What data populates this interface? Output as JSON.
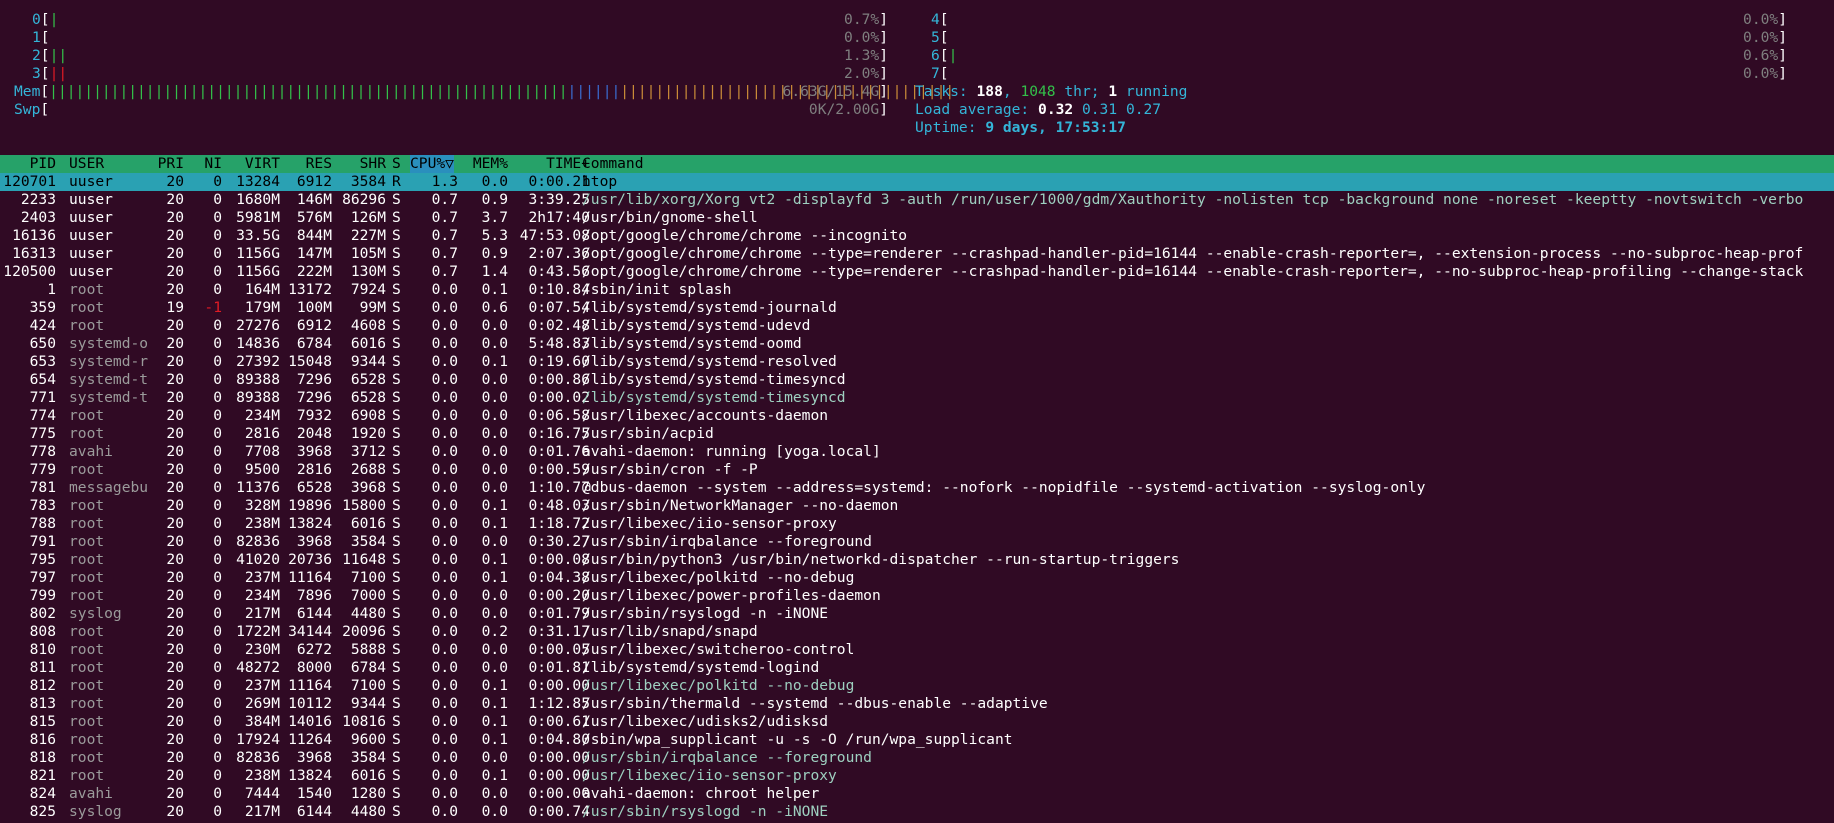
{
  "cpus_left": [
    {
      "id": "0",
      "bar": "|",
      "bar_color": "green",
      "pct": "0.7%"
    },
    {
      "id": "1",
      "bar": "",
      "bar_color": "green",
      "pct": "0.0%"
    },
    {
      "id": "2",
      "bar": "||",
      "bar_color": "green",
      "pct": "1.3%"
    },
    {
      "id": "3",
      "bar": "||",
      "bar_color": "red",
      "pct": "2.0%"
    }
  ],
  "cpus_right": [
    {
      "id": "4",
      "bar": "",
      "bar_color": "green",
      "pct": "0.0%"
    },
    {
      "id": "5",
      "bar": "",
      "bar_color": "green",
      "pct": "0.0%"
    },
    {
      "id": "6",
      "bar": "|",
      "bar_color": "green",
      "pct": "0.6%"
    },
    {
      "id": "7",
      "bar": "",
      "bar_color": "green",
      "pct": "0.0%"
    }
  ],
  "mem": {
    "label": "Mem",
    "green": "|||||||||||||||||||||||||||||||||||||||||||||||||||||||||||",
    "blue": "||||||",
    "orange": "||||||||||||||||||||||||||||||||||||||",
    "value": "6.63G/15.4G"
  },
  "swp": {
    "label": "Swp",
    "value": "0K/2.00G"
  },
  "tasks": {
    "label": "Tasks:",
    "count": "188",
    "thr": "1048",
    "thr_label": " thr;",
    "running": "1",
    "running_label": " running"
  },
  "load": {
    "label": "Load average:",
    "v1": "0.32",
    "v5": "0.31",
    "v15": "0.27"
  },
  "uptime": {
    "label": "Uptime:",
    "value": "9 days, 17:53:17"
  },
  "header": {
    "pid": "PID",
    "user": "USER",
    "pri": "PRI",
    "ni": "NI",
    "virt": "VIRT",
    "res": "RES",
    "shr": "SHR",
    "s": "S",
    "cpu": "CPU%▽",
    "mem": "MEM%",
    "time": "TIME+",
    "cmd": "Command"
  },
  "processes": [
    {
      "pid": "120701",
      "user": "uuser",
      "pri": "20",
      "ni": "0",
      "virt": "13284",
      "res": "6912",
      "shr": "3584",
      "s": "R",
      "cpu": "1.3",
      "mem": "0.0",
      "time": "0:00.21",
      "cmd": "htop",
      "selected": true
    },
    {
      "pid": "2233",
      "user": "uuser",
      "pri": "20",
      "ni": "0",
      "virt": "1680M",
      "res": "146M",
      "shr": "86296",
      "s": "S",
      "cpu": "0.7",
      "mem": "0.9",
      "time": "3:39.25",
      "cmd": "/usr/lib/xorg/Xorg vt2 -displayfd 3 -auth /run/user/1000/gdm/Xauthority -nolisten tcp -background none -noreset -keeptty -novtswitch -verbo",
      "thread": true
    },
    {
      "pid": "2403",
      "user": "uuser",
      "pri": "20",
      "ni": "0",
      "virt": "5981M",
      "res": "576M",
      "shr": "126M",
      "s": "S",
      "cpu": "0.7",
      "mem": "3.7",
      "time": "2h17:40",
      "cmd": "/usr/bin/gnome-shell"
    },
    {
      "pid": "16136",
      "user": "uuser",
      "pri": "20",
      "ni": "0",
      "virt": "33.5G",
      "res": "844M",
      "shr": "227M",
      "s": "S",
      "cpu": "0.7",
      "mem": "5.3",
      "time": "47:53.08",
      "cmd": "/opt/google/chrome/chrome --incognito"
    },
    {
      "pid": "16313",
      "user": "uuser",
      "pri": "20",
      "ni": "0",
      "virt": "1156G",
      "res": "147M",
      "shr": "105M",
      "s": "S",
      "cpu": "0.7",
      "mem": "0.9",
      "time": "2:07.36",
      "cmd": "/opt/google/chrome/chrome --type=renderer --crashpad-handler-pid=16144 --enable-crash-reporter=, --extension-process --no-subproc-heap-prof"
    },
    {
      "pid": "120500",
      "user": "uuser",
      "pri": "20",
      "ni": "0",
      "virt": "1156G",
      "res": "222M",
      "shr": "130M",
      "s": "S",
      "cpu": "0.7",
      "mem": "1.4",
      "time": "0:43.56",
      "cmd": "/opt/google/chrome/chrome --type=renderer --crashpad-handler-pid=16144 --enable-crash-reporter=, --no-subproc-heap-profiling --change-stack"
    },
    {
      "pid": "1",
      "user": "root",
      "pri": "20",
      "ni": "0",
      "virt": "164M",
      "res": "13172",
      "shr": "7924",
      "s": "S",
      "cpu": "0.0",
      "mem": "0.1",
      "time": "0:10.84",
      "cmd": "/sbin/init splash"
    },
    {
      "pid": "359",
      "user": "root",
      "pri": "19",
      "ni": "-1",
      "virt": "179M",
      "res": "100M",
      "shr": "99M",
      "s": "S",
      "cpu": "0.0",
      "mem": "0.6",
      "time": "0:07.54",
      "cmd": "/lib/systemd/systemd-journald"
    },
    {
      "pid": "424",
      "user": "root",
      "pri": "20",
      "ni": "0",
      "virt": "27276",
      "res": "6912",
      "shr": "4608",
      "s": "S",
      "cpu": "0.0",
      "mem": "0.0",
      "time": "0:02.48",
      "cmd": "/lib/systemd/systemd-udevd"
    },
    {
      "pid": "650",
      "user": "systemd-o",
      "pri": "20",
      "ni": "0",
      "virt": "14836",
      "res": "6784",
      "shr": "6016",
      "s": "S",
      "cpu": "0.0",
      "mem": "0.0",
      "time": "5:48.83",
      "cmd": "/lib/systemd/systemd-oomd"
    },
    {
      "pid": "653",
      "user": "systemd-r",
      "pri": "20",
      "ni": "0",
      "virt": "27392",
      "res": "15048",
      "shr": "9344",
      "s": "S",
      "cpu": "0.0",
      "mem": "0.1",
      "time": "0:19.60",
      "cmd": "/lib/systemd/systemd-resolved"
    },
    {
      "pid": "654",
      "user": "systemd-t",
      "pri": "20",
      "ni": "0",
      "virt": "89388",
      "res": "7296",
      "shr": "6528",
      "s": "S",
      "cpu": "0.0",
      "mem": "0.0",
      "time": "0:00.86",
      "cmd": "/lib/systemd/systemd-timesyncd"
    },
    {
      "pid": "771",
      "user": "systemd-t",
      "pri": "20",
      "ni": "0",
      "virt": "89388",
      "res": "7296",
      "shr": "6528",
      "s": "S",
      "cpu": "0.0",
      "mem": "0.0",
      "time": "0:00.02",
      "cmd": "/lib/systemd/systemd-timesyncd",
      "thread": true
    },
    {
      "pid": "774",
      "user": "root",
      "pri": "20",
      "ni": "0",
      "virt": "234M",
      "res": "7932",
      "shr": "6908",
      "s": "S",
      "cpu": "0.0",
      "mem": "0.0",
      "time": "0:06.58",
      "cmd": "/usr/libexec/accounts-daemon"
    },
    {
      "pid": "775",
      "user": "root",
      "pri": "20",
      "ni": "0",
      "virt": "2816",
      "res": "2048",
      "shr": "1920",
      "s": "S",
      "cpu": "0.0",
      "mem": "0.0",
      "time": "0:16.75",
      "cmd": "/usr/sbin/acpid"
    },
    {
      "pid": "778",
      "user": "avahi",
      "pri": "20",
      "ni": "0",
      "virt": "7708",
      "res": "3968",
      "shr": "3712",
      "s": "S",
      "cpu": "0.0",
      "mem": "0.0",
      "time": "0:01.76",
      "cmd": "avahi-daemon: running [yoga.local]"
    },
    {
      "pid": "779",
      "user": "root",
      "pri": "20",
      "ni": "0",
      "virt": "9500",
      "res": "2816",
      "shr": "2688",
      "s": "S",
      "cpu": "0.0",
      "mem": "0.0",
      "time": "0:00.59",
      "cmd": "/usr/sbin/cron -f -P"
    },
    {
      "pid": "781",
      "user": "messagebu",
      "pri": "20",
      "ni": "0",
      "virt": "11376",
      "res": "6528",
      "shr": "3968",
      "s": "S",
      "cpu": "0.0",
      "mem": "0.0",
      "time": "1:10.77",
      "cmd": "@dbus-daemon --system --address=systemd: --nofork --nopidfile --systemd-activation --syslog-only"
    },
    {
      "pid": "783",
      "user": "root",
      "pri": "20",
      "ni": "0",
      "virt": "328M",
      "res": "19896",
      "shr": "15800",
      "s": "S",
      "cpu": "0.0",
      "mem": "0.1",
      "time": "0:48.03",
      "cmd": "/usr/sbin/NetworkManager --no-daemon"
    },
    {
      "pid": "788",
      "user": "root",
      "pri": "20",
      "ni": "0",
      "virt": "238M",
      "res": "13824",
      "shr": "6016",
      "s": "S",
      "cpu": "0.0",
      "mem": "0.1",
      "time": "1:18.72",
      "cmd": "/usr/libexec/iio-sensor-proxy"
    },
    {
      "pid": "791",
      "user": "root",
      "pri": "20",
      "ni": "0",
      "virt": "82836",
      "res": "3968",
      "shr": "3584",
      "s": "S",
      "cpu": "0.0",
      "mem": "0.0",
      "time": "0:30.27",
      "cmd": "/usr/sbin/irqbalance --foreground"
    },
    {
      "pid": "795",
      "user": "root",
      "pri": "20",
      "ni": "0",
      "virt": "41020",
      "res": "20736",
      "shr": "11648",
      "s": "S",
      "cpu": "0.0",
      "mem": "0.1",
      "time": "0:00.08",
      "cmd": "/usr/bin/python3 /usr/bin/networkd-dispatcher --run-startup-triggers"
    },
    {
      "pid": "797",
      "user": "root",
      "pri": "20",
      "ni": "0",
      "virt": "237M",
      "res": "11164",
      "shr": "7100",
      "s": "S",
      "cpu": "0.0",
      "mem": "0.1",
      "time": "0:04.38",
      "cmd": "/usr/libexec/polkitd --no-debug"
    },
    {
      "pid": "799",
      "user": "root",
      "pri": "20",
      "ni": "0",
      "virt": "234M",
      "res": "7896",
      "shr": "7000",
      "s": "S",
      "cpu": "0.0",
      "mem": "0.0",
      "time": "0:00.20",
      "cmd": "/usr/libexec/power-profiles-daemon"
    },
    {
      "pid": "802",
      "user": "syslog",
      "pri": "20",
      "ni": "0",
      "virt": "217M",
      "res": "6144",
      "shr": "4480",
      "s": "S",
      "cpu": "0.0",
      "mem": "0.0",
      "time": "0:01.79",
      "cmd": "/usr/sbin/rsyslogd -n -iNONE"
    },
    {
      "pid": "808",
      "user": "root",
      "pri": "20",
      "ni": "0",
      "virt": "1722M",
      "res": "34144",
      "shr": "20096",
      "s": "S",
      "cpu": "0.0",
      "mem": "0.2",
      "time": "0:31.17",
      "cmd": "/usr/lib/snapd/snapd"
    },
    {
      "pid": "810",
      "user": "root",
      "pri": "20",
      "ni": "0",
      "virt": "230M",
      "res": "6272",
      "shr": "5888",
      "s": "S",
      "cpu": "0.0",
      "mem": "0.0",
      "time": "0:00.05",
      "cmd": "/usr/libexec/switcheroo-control"
    },
    {
      "pid": "811",
      "user": "root",
      "pri": "20",
      "ni": "0",
      "virt": "48272",
      "res": "8000",
      "shr": "6784",
      "s": "S",
      "cpu": "0.0",
      "mem": "0.0",
      "time": "0:01.81",
      "cmd": "/lib/systemd/systemd-logind"
    },
    {
      "pid": "812",
      "user": "root",
      "pri": "20",
      "ni": "0",
      "virt": "237M",
      "res": "11164",
      "shr": "7100",
      "s": "S",
      "cpu": "0.0",
      "mem": "0.1",
      "time": "0:00.00",
      "cmd": "/usr/libexec/polkitd --no-debug",
      "thread": true
    },
    {
      "pid": "813",
      "user": "root",
      "pri": "20",
      "ni": "0",
      "virt": "269M",
      "res": "10112",
      "shr": "9344",
      "s": "S",
      "cpu": "0.0",
      "mem": "0.1",
      "time": "1:12.85",
      "cmd": "/usr/sbin/thermald --systemd --dbus-enable --adaptive"
    },
    {
      "pid": "815",
      "user": "root",
      "pri": "20",
      "ni": "0",
      "virt": "384M",
      "res": "14016",
      "shr": "10816",
      "s": "S",
      "cpu": "0.0",
      "mem": "0.1",
      "time": "0:00.61",
      "cmd": "/usr/libexec/udisks2/udisksd"
    },
    {
      "pid": "816",
      "user": "root",
      "pri": "20",
      "ni": "0",
      "virt": "17924",
      "res": "11264",
      "shr": "9600",
      "s": "S",
      "cpu": "0.0",
      "mem": "0.1",
      "time": "0:04.80",
      "cmd": "/sbin/wpa_supplicant -u -s -O /run/wpa_supplicant"
    },
    {
      "pid": "818",
      "user": "root",
      "pri": "20",
      "ni": "0",
      "virt": "82836",
      "res": "3968",
      "shr": "3584",
      "s": "S",
      "cpu": "0.0",
      "mem": "0.0",
      "time": "0:00.00",
      "cmd": "/usr/sbin/irqbalance --foreground",
      "thread": true
    },
    {
      "pid": "821",
      "user": "root",
      "pri": "20",
      "ni": "0",
      "virt": "238M",
      "res": "13824",
      "shr": "6016",
      "s": "S",
      "cpu": "0.0",
      "mem": "0.1",
      "time": "0:00.00",
      "cmd": "/usr/libexec/iio-sensor-proxy",
      "thread": true
    },
    {
      "pid": "824",
      "user": "avahi",
      "pri": "20",
      "ni": "0",
      "virt": "7444",
      "res": "1540",
      "shr": "1280",
      "s": "S",
      "cpu": "0.0",
      "mem": "0.0",
      "time": "0:00.00",
      "cmd": "avahi-daemon: chroot helper"
    },
    {
      "pid": "825",
      "user": "syslog",
      "pri": "20",
      "ni": "0",
      "virt": "217M",
      "res": "6144",
      "shr": "4480",
      "s": "S",
      "cpu": "0.0",
      "mem": "0.0",
      "time": "0:00.74",
      "cmd": "/usr/sbin/rsyslogd -n -iNONE",
      "thread": true
    }
  ],
  "colors": {
    "background": "#300a24",
    "header_bg": "#26a269",
    "selected_bg": "#2aa1b3",
    "label": "#34b5d8",
    "green": "#33c04a",
    "red": "#e01b24"
  }
}
